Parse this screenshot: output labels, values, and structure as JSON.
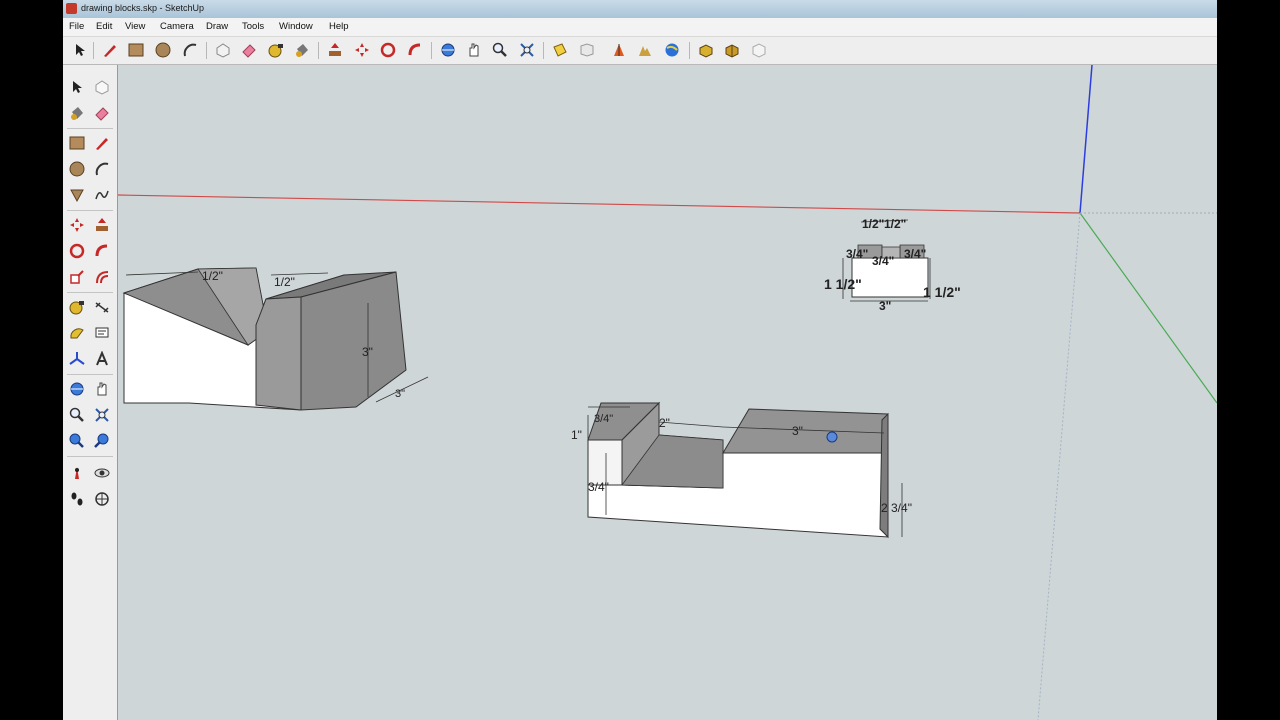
{
  "window": {
    "title": "drawing blocks.skp - SketchUp"
  },
  "menu": [
    "File",
    "Edit",
    "View",
    "Camera",
    "Draw",
    "Tools",
    "Window",
    "Help"
  ],
  "toolbar_icons": [
    "select-icon",
    "pencil-icon",
    "rectangle-icon",
    "circle-icon",
    "arc-icon",
    "make-component-icon",
    "eraser-icon",
    "tape-measure-icon",
    "paint-bucket-icon",
    "push-pull-icon",
    "move-icon",
    "rotate-icon",
    "follow-me-icon",
    "orbit-icon",
    "pan-icon",
    "zoom-icon",
    "zoom-extents-icon",
    "section-plane-icon",
    "get-models-icon",
    "add-location-icon",
    "terrain-icon",
    "google-earth-icon",
    "share-model-icon",
    "components-icon",
    "preview-icon"
  ],
  "left_tool_icons": [
    [
      "select-icon",
      "make-component-icon"
    ],
    [
      "paint-bucket-icon",
      "eraser-icon"
    ],
    [
      "rectangle-icon",
      "line-icon"
    ],
    [
      "circle-icon",
      "arc-icon"
    ],
    [
      "polygon-icon",
      "freehand-icon"
    ],
    [
      "move-icon",
      "push-pull-icon"
    ],
    [
      "rotate-icon",
      "follow-me-icon"
    ],
    [
      "scale-icon",
      "offset-icon"
    ],
    [
      "tape-measure-icon",
      "dimension-icon"
    ],
    [
      "protractor-icon",
      "text-icon"
    ],
    [
      "axes-icon",
      "3d-text-icon"
    ],
    [
      "orbit-icon",
      "pan-icon"
    ],
    [
      "zoom-icon",
      "zoom-window-icon"
    ],
    [
      "zoom-extents-icon",
      "previous-view-icon"
    ],
    [
      "position-camera-icon",
      "look-around-icon"
    ],
    [
      "walk-icon",
      "section-plane-icon"
    ]
  ],
  "dimensions": {
    "v_block": {
      "top_left": "1/2\"",
      "top_right": "1/2\"",
      "height": "3\"",
      "depth": "3\""
    },
    "step_block": {
      "left_height": "1\"",
      "left_width": "3/4\"",
      "middle_width": "2\"",
      "right_width": "3\"",
      "inner_depth": "3/4\"",
      "right_height": "2 3/4\""
    },
    "small_block": {
      "top_a": "1/2\"",
      "top_b": "1/2\"",
      "mid_left": "3/4\"",
      "mid_right": "3/4\"",
      "mid_center": "3/4\"",
      "left_height": "1 1/2\"",
      "right_height": "1 1/2\"",
      "bottom_width": "3\""
    }
  },
  "colors": {
    "background": "#cfd6d8",
    "red_axis": "#d04a4a",
    "green_axis": "#4aaa55",
    "blue_axis": "#2b3de0",
    "face_top": "#9a9a9a",
    "face_front": "#ffffff"
  }
}
